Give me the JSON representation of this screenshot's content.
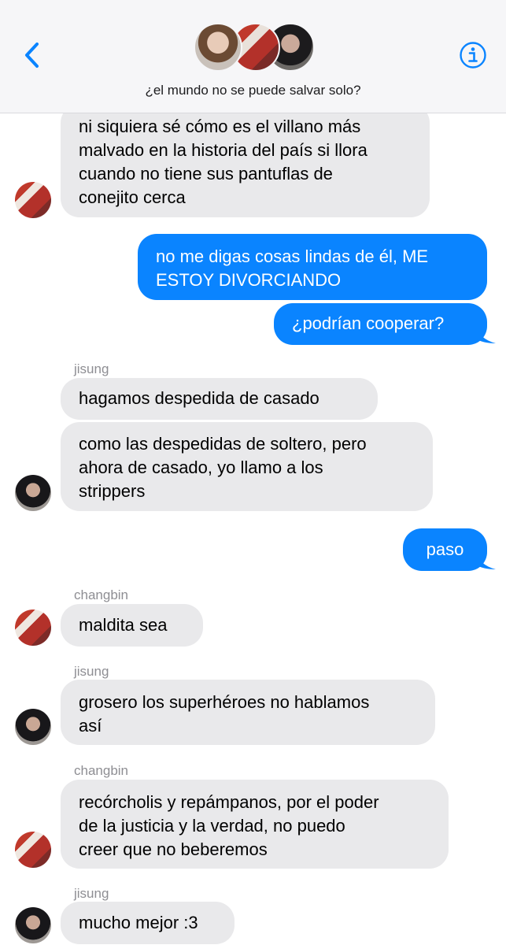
{
  "header": {
    "chat_title": "¿el mundo no se puede salvar solo?",
    "back_icon": "chevron-left-icon",
    "info_icon": "info-circle-icon",
    "accent_color": "#0a84ff"
  },
  "messages": [
    {
      "sender": "changbin",
      "direction": "incoming",
      "text_lines": [
        "ni siquiera sé cómo es el villano más",
        "malvado en la historia del país si llora",
        "cuando no tiene sus pantuflas de",
        "conejito cerca"
      ]
    },
    {
      "sender": "",
      "direction": "outgoing",
      "text_lines": [
        "no me digas cosas lindas de él, ME",
        "ESTOY DIVORCIANDO"
      ]
    },
    {
      "sender": "",
      "direction": "outgoing",
      "text_lines": [
        "¿podrían cooperar?"
      ]
    },
    {
      "sender": "jisung",
      "direction": "incoming",
      "text_lines": [
        "hagamos despedida de casado"
      ]
    },
    {
      "sender": "jisung",
      "direction": "incoming",
      "text_lines": [
        "como las despedidas de soltero, pero",
        "ahora de casado, yo llamo a los",
        "strippers"
      ]
    },
    {
      "sender": "",
      "direction": "outgoing",
      "text_lines": [
        "paso"
      ]
    },
    {
      "sender": "changbin",
      "direction": "incoming",
      "text_lines": [
        "maldita sea"
      ]
    },
    {
      "sender": "jisung",
      "direction": "incoming",
      "text_lines": [
        "grosero los superhéroes no hablamos",
        "así"
      ]
    },
    {
      "sender": "changbin",
      "direction": "incoming",
      "text_lines": [
        "recórcholis y repámpanos, por el poder",
        "de la justicia y la verdad, no puedo",
        "creer que no beberemos"
      ]
    },
    {
      "sender": "jisung",
      "direction": "incoming",
      "text_lines": [
        "mucho mejor :3"
      ]
    }
  ],
  "sender_labels": {
    "jisung_1": "jisung",
    "changbin_1": "changbin",
    "jisung_2": "jisung",
    "changbin_2": "changbin",
    "jisung_3": "jisung"
  }
}
